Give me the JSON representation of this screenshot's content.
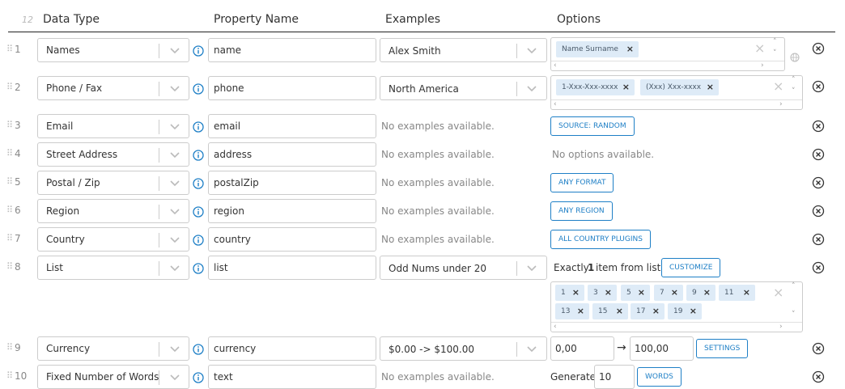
{
  "header": {
    "row_count": "12",
    "data_type": "Data Type",
    "property_name": "Property Name",
    "examples": "Examples",
    "options": "Options"
  },
  "icons": {
    "drag": "drag-handle-icon",
    "dropdown": "chevron-down-icon",
    "info": "info-circle-icon",
    "delete": "close-circle-icon",
    "remove_tag": "x-icon",
    "globe": "globe-icon",
    "arrow": "arrow-right-icon"
  },
  "colors": {
    "accent": "#1e7fc6",
    "tag_bg": "#deebf7"
  },
  "rows": [
    {
      "num": "1",
      "data_type": "Names",
      "property": "name",
      "example": "Alex Smith",
      "options": {
        "tags": [
          "Name Surname"
        ]
      }
    },
    {
      "num": "2",
      "data_type": "Phone / Fax",
      "property": "phone",
      "example": "North America",
      "options": {
        "tags": [
          "1-Xxx-Xxx-xxxx",
          "(Xxx) Xxx-xxxx"
        ]
      }
    },
    {
      "num": "3",
      "data_type": "Email",
      "property": "email",
      "example": "No examples available.",
      "options": {
        "button": "SOURCE: RANDOM"
      }
    },
    {
      "num": "4",
      "data_type": "Street Address",
      "property": "address",
      "example": "No examples available.",
      "options": {
        "text": "No options available."
      }
    },
    {
      "num": "5",
      "data_type": "Postal / Zip",
      "property": "postalZip",
      "example": "No examples available.",
      "options": {
        "button": "ANY FORMAT"
      }
    },
    {
      "num": "6",
      "data_type": "Region",
      "property": "region",
      "example": "No examples available.",
      "options": {
        "button": "ANY REGION"
      }
    },
    {
      "num": "7",
      "data_type": "Country",
      "property": "country",
      "example": "No examples available.",
      "options": {
        "button": "ALL COUNTRY PLUGINS"
      }
    },
    {
      "num": "8",
      "data_type": "List",
      "property": "list",
      "example": "Odd Nums under 20",
      "options": {
        "text_prefix": "Exactly",
        "count": "1",
        "text_suffix": "item from list",
        "button": "CUSTOMIZE",
        "tags": [
          "1",
          "3",
          "5",
          "7",
          "9",
          "11",
          "13",
          "15",
          "17",
          "19"
        ]
      }
    },
    {
      "num": "9",
      "data_type": "Currency",
      "property": "currency",
      "example": "$0.00 -> $100.00",
      "options": {
        "from": "0,00",
        "arrow": "→",
        "to": "100,00",
        "button": "SETTINGS"
      }
    },
    {
      "num": "10",
      "data_type": "Fixed Number of Words",
      "property": "text",
      "example": "No examples available.",
      "options": {
        "label": "Generate",
        "value": "10",
        "button": "WORDS"
      }
    }
  ]
}
